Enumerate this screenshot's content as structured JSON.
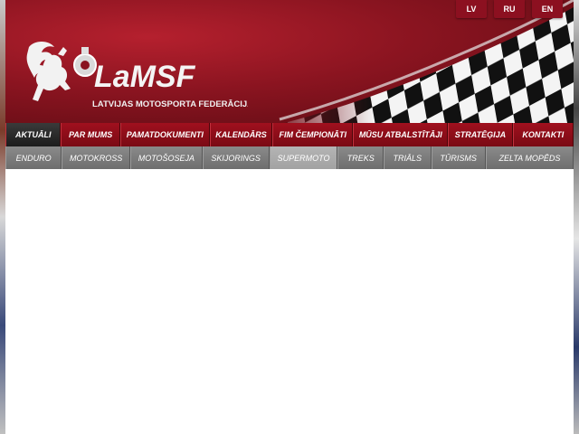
{
  "brand": {
    "name": "LaMSF",
    "subtitle": "LATVIJAS MOTOSPORTA FEDERĀCIJA",
    "accent": "#8c1020"
  },
  "languages": [
    "LV",
    "RU",
    "EN"
  ],
  "main_nav": [
    {
      "label": "AKTUĀLI"
    },
    {
      "label": "PAR MUMS"
    },
    {
      "label": "PAMATDOKUMENTI"
    },
    {
      "label": "KALENDĀRS"
    },
    {
      "label": "FIM ČEMPIONĀTI"
    },
    {
      "label": "MŪSU ATBALSTĪTĀJI"
    },
    {
      "label": "STRATĒĢIJA"
    },
    {
      "label": "KONTAKTI"
    }
  ],
  "sub_nav": [
    {
      "label": "ENDURO"
    },
    {
      "label": "MOTOKROSS"
    },
    {
      "label": "MOTOŠOSEJA"
    },
    {
      "label": "SKIJORINGS"
    },
    {
      "label": "SUPERMOTO"
    },
    {
      "label": "TREKS"
    },
    {
      "label": "TRIĀLS"
    },
    {
      "label": "TŪRISMS"
    },
    {
      "label": "ZELTA MOPĒDS"
    }
  ]
}
